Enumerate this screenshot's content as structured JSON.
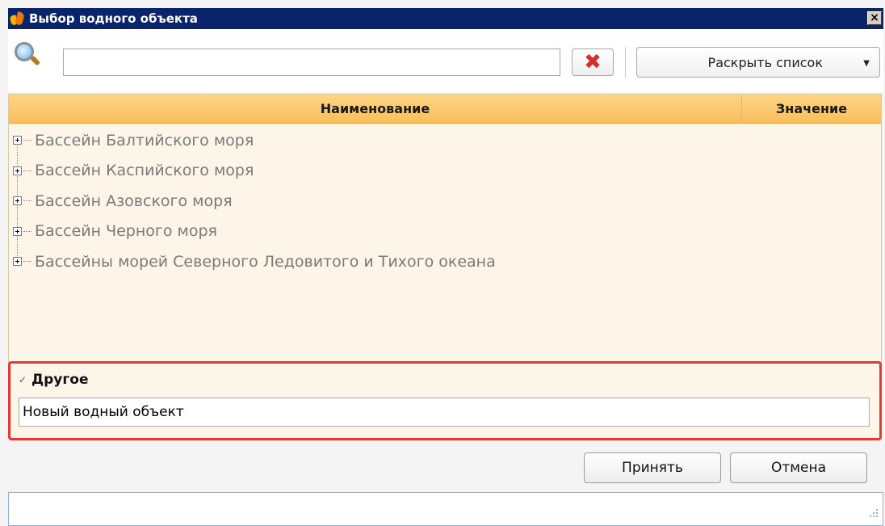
{
  "window": {
    "title": "Выбор водного объекта",
    "close_label": "×"
  },
  "toolbar": {
    "search_value": "",
    "clear_label": "✖",
    "expand_label": "Раскрыть список",
    "expand_caret": "▼"
  },
  "grid": {
    "columns": {
      "name": "Наименование",
      "value": "Значение"
    },
    "items": [
      {
        "label": "Бассейн Балтийского моря"
      },
      {
        "label": "Бассейн Каспийского моря"
      },
      {
        "label": "Бассейн Азовского моря"
      },
      {
        "label": "Бассейн Черного моря"
      },
      {
        "label": "Бассейны морей Северного Ледовитого и Тихого океана"
      }
    ]
  },
  "other": {
    "checked": true,
    "check_glyph": "✓",
    "label": "Другое",
    "value": "Новый водный объект"
  },
  "buttons": {
    "accept": "Принять",
    "cancel": "Отмена"
  },
  "colors": {
    "titlebar": "#0a246a",
    "header": "#f9be5c",
    "highlight_border": "#e53935",
    "clear_icon": "#d32f2f"
  }
}
